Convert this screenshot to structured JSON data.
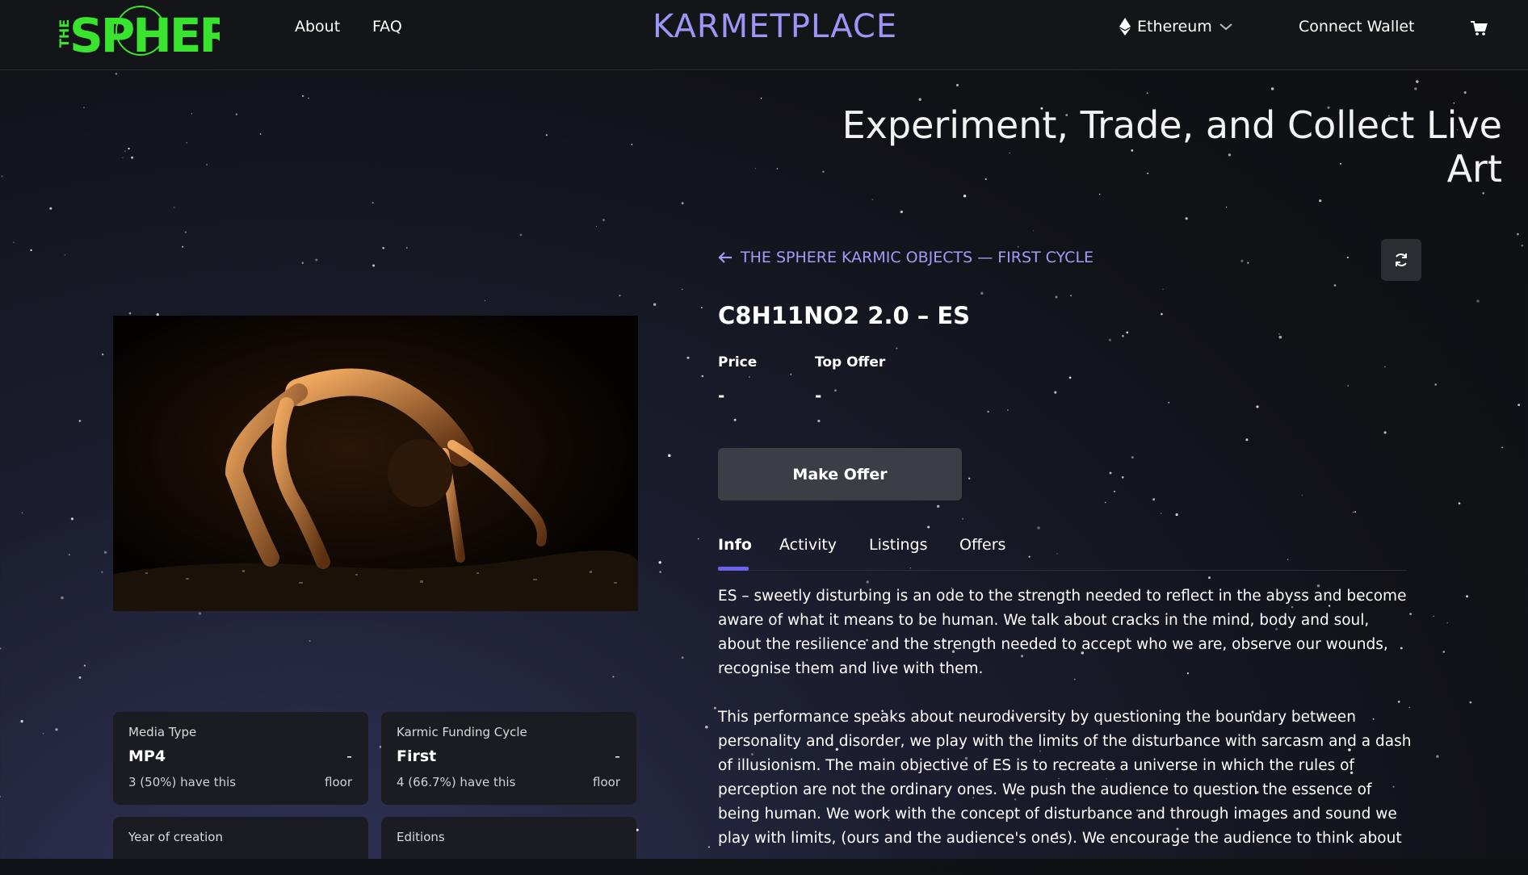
{
  "header": {
    "logo_text": "THE SPHERE",
    "nav": [
      "About",
      "FAQ"
    ],
    "brand": "KARMETPLACE",
    "network": "Ethereum",
    "connect_wallet": "Connect Wallet"
  },
  "hero": {
    "title": "Experiment, Trade, and Collect Live Art"
  },
  "item": {
    "collection_link": "THE SPHERE KARMIC OBJECTS — FIRST CYCLE",
    "title": "C8H11NO2 2.0 – ES",
    "price_label": "Price",
    "price_value": "-",
    "top_offer_label": "Top Offer",
    "top_offer_value": "-",
    "make_offer": "Make Offer"
  },
  "tabs": [
    "Info",
    "Activity",
    "Listings",
    "Offers"
  ],
  "description": [
    "ES – sweetly disturbing is an ode to the strength needed to reflect in the abyss and become aware of what it means to be human. We talk about cracks in the mind, body and soul, about the resilience and the strength needed to accept who we are, observe our wounds, recognise them and live with them.",
    "This performance speaks about neurodiversity by questioning the boundary between personality and disorder, we play with the limits of the disturbance with sarcasm and a dash of illusionism. The main objective of ES is to recreate a universe in which the rules of perception are not the ordinary ones. We push the audience to question the essence of being human. We work with the concept of disturbance and through images and sound we play with limits, (ours and the audience's ones). We encourage the audience to think about"
  ],
  "traits": [
    {
      "label": "Media Type",
      "value": "MP4",
      "dash": "-",
      "note": "3 (50%) have this",
      "floor": "floor"
    },
    {
      "label": "Karmic Funding Cycle",
      "value": "First",
      "dash": "-",
      "note": "4 (66.7%) have this",
      "floor": "floor"
    },
    {
      "label": "Year of creation",
      "value": "",
      "dash": "",
      "note": "",
      "floor": ""
    },
    {
      "label": "Editions",
      "value": "",
      "dash": "",
      "note": "",
      "floor": ""
    }
  ],
  "colors": {
    "accent": "#9e96f4",
    "logo": "#39e42f",
    "button": "#3b3e45",
    "tab_indicator": "#6c63e8"
  },
  "icons": [
    "ethereum-icon",
    "chevron-down-icon",
    "cart-icon",
    "arrow-left-icon",
    "refresh-icon"
  ]
}
